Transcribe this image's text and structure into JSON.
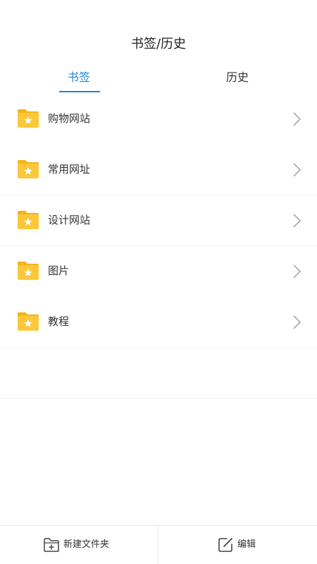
{
  "header": {
    "title": "书签/历史"
  },
  "tabs": [
    {
      "label": "书签",
      "active": true
    },
    {
      "label": "历史",
      "active": false
    }
  ],
  "bookmarks": {
    "folders": [
      {
        "label": "购物网站",
        "icon": "folder-star-icon"
      },
      {
        "label": "常用网址",
        "icon": "folder-star-icon"
      },
      {
        "label": "设计网站",
        "icon": "folder-star-icon"
      },
      {
        "label": "图片",
        "icon": "folder-star-icon"
      },
      {
        "label": "教程",
        "icon": "folder-star-icon"
      }
    ]
  },
  "toolbar": {
    "new_folder_label": "新建文件夹",
    "new_folder_icon": "new-folder-icon",
    "edit_label": "编辑",
    "edit_icon": "edit-icon"
  },
  "colors": {
    "accent": "#1f85d8",
    "folder_back": "#f5b41c",
    "folder_front": "#fcc83a",
    "chevron": "#a8a8a8"
  }
}
